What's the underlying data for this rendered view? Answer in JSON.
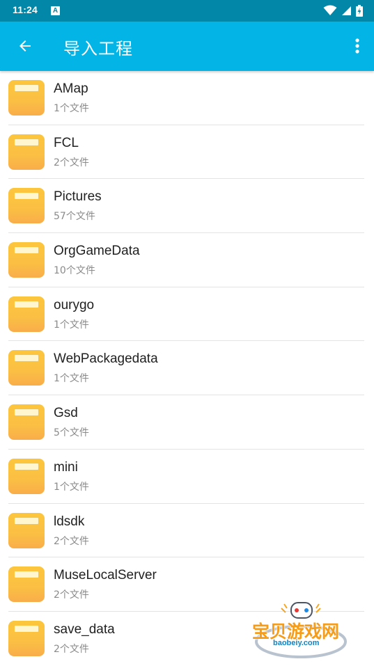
{
  "status_bar": {
    "time": "11:24",
    "notification_badge": "A"
  },
  "app_bar": {
    "title": "导入工程",
    "back_icon": "arrow-left-icon",
    "more_icon": "more-vert-icon"
  },
  "folders": [
    {
      "name": "AMap",
      "count": "1个文件"
    },
    {
      "name": "FCL",
      "count": "2个文件"
    },
    {
      "name": "Pictures",
      "count": "57个文件"
    },
    {
      "name": "OrgGameData",
      "count": "10个文件"
    },
    {
      "name": "ourygo",
      "count": "1个文件"
    },
    {
      "name": "WebPackagedata",
      "count": "1个文件"
    },
    {
      "name": "Gsd",
      "count": "5个文件"
    },
    {
      "name": "mini",
      "count": "1个文件"
    },
    {
      "name": "ldsdk",
      "count": "2个文件"
    },
    {
      "name": "MuseLocalServer",
      "count": "2个文件"
    },
    {
      "name": "save_data",
      "count": "2个文件"
    }
  ],
  "watermark": {
    "text": "宝贝游戏网",
    "url": "baobeiy.com"
  },
  "colors": {
    "status_bar": "#0287a8",
    "app_bar": "#03b4e6",
    "folder": "#fbbf44"
  }
}
